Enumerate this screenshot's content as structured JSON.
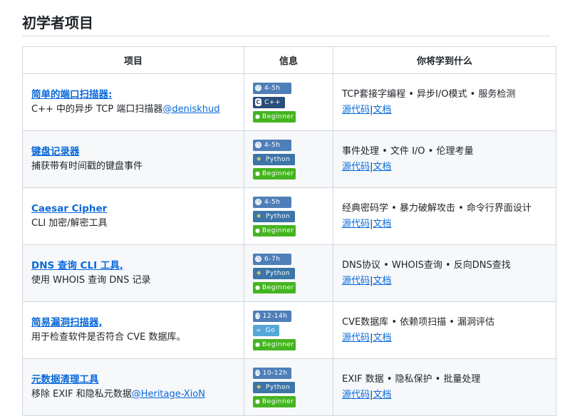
{
  "section": {
    "title": "初学者项目"
  },
  "table": {
    "headers": {
      "project": "项目",
      "info": "信息",
      "learn": "你将学到什么"
    },
    "rows": [
      {
        "name": "简单的端口扫描器:",
        "description": "C++ 中的异步 TCP 端口扫描器",
        "author": "@deniskhud",
        "time": "4-5h",
        "language": "C++",
        "language_icon": "cpp-icon",
        "level": "Beginner",
        "topics": "TCP套接字编程 • 异步I/O模式 • 服务检测",
        "source_link": "源代码",
        "docs_link": "文档"
      },
      {
        "name": "键盘记录器",
        "description": "捕获带有时间戳的键盘事件",
        "author": "",
        "time": "4-5h",
        "language": "Python",
        "language_icon": "python-icon",
        "level": "Beginner",
        "topics": "事件处理 • 文件 I/O • 伦理考量",
        "source_link": "源代码",
        "docs_link": "文档"
      },
      {
        "name": "Caesar Cipher",
        "description": "CLI 加密/解密工具",
        "author": "",
        "time": "4-5h",
        "language": "Python",
        "language_icon": "python-icon",
        "level": "Beginner",
        "topics": "经典密码学 • 暴力破解攻击 • 命令行界面设计",
        "source_link": "源代码",
        "docs_link": "文档"
      },
      {
        "name": "DNS 查询 CLI 工具,",
        "description": "使用 WHOIS 查询 DNS 记录",
        "author": "",
        "time": "6-7h",
        "language": "Python",
        "language_icon": "python-icon",
        "level": "Beginner",
        "topics": "DNS协议 • WHOIS查询 • 反向DNS查找",
        "source_link": "源代码",
        "docs_link": "文档"
      },
      {
        "name": "简易漏洞扫描器,",
        "description": "用于检查软件是否符合 CVE 数据库。",
        "author": "",
        "time": "12-14h",
        "language": "Go",
        "language_icon": "go-icon",
        "level": "Beginner",
        "topics": "CVE数据库 • 依赖项扫描 • 漏洞评估",
        "source_link": "源代码",
        "docs_link": "文档"
      },
      {
        "name": "元数据清理工具",
        "description": "移除 EXIF 和隐私元数据",
        "author": "@Heritage-XioN",
        "time": "10-12h",
        "language": "Python",
        "language_icon": "python-icon",
        "level": "Beginner",
        "topics": "EXIF 数据 • 隐私保护 • 批量处理",
        "source_link": "源代码",
        "docs_link": "文档"
      }
    ]
  },
  "colors": {
    "link": "#0969da",
    "time_badge": "#4f7fb8",
    "level_badge": "#44b520",
    "python_badge": "#3c75a8",
    "cpp_badge": "#2a4d7a",
    "go_badge": "#55a7d8"
  }
}
